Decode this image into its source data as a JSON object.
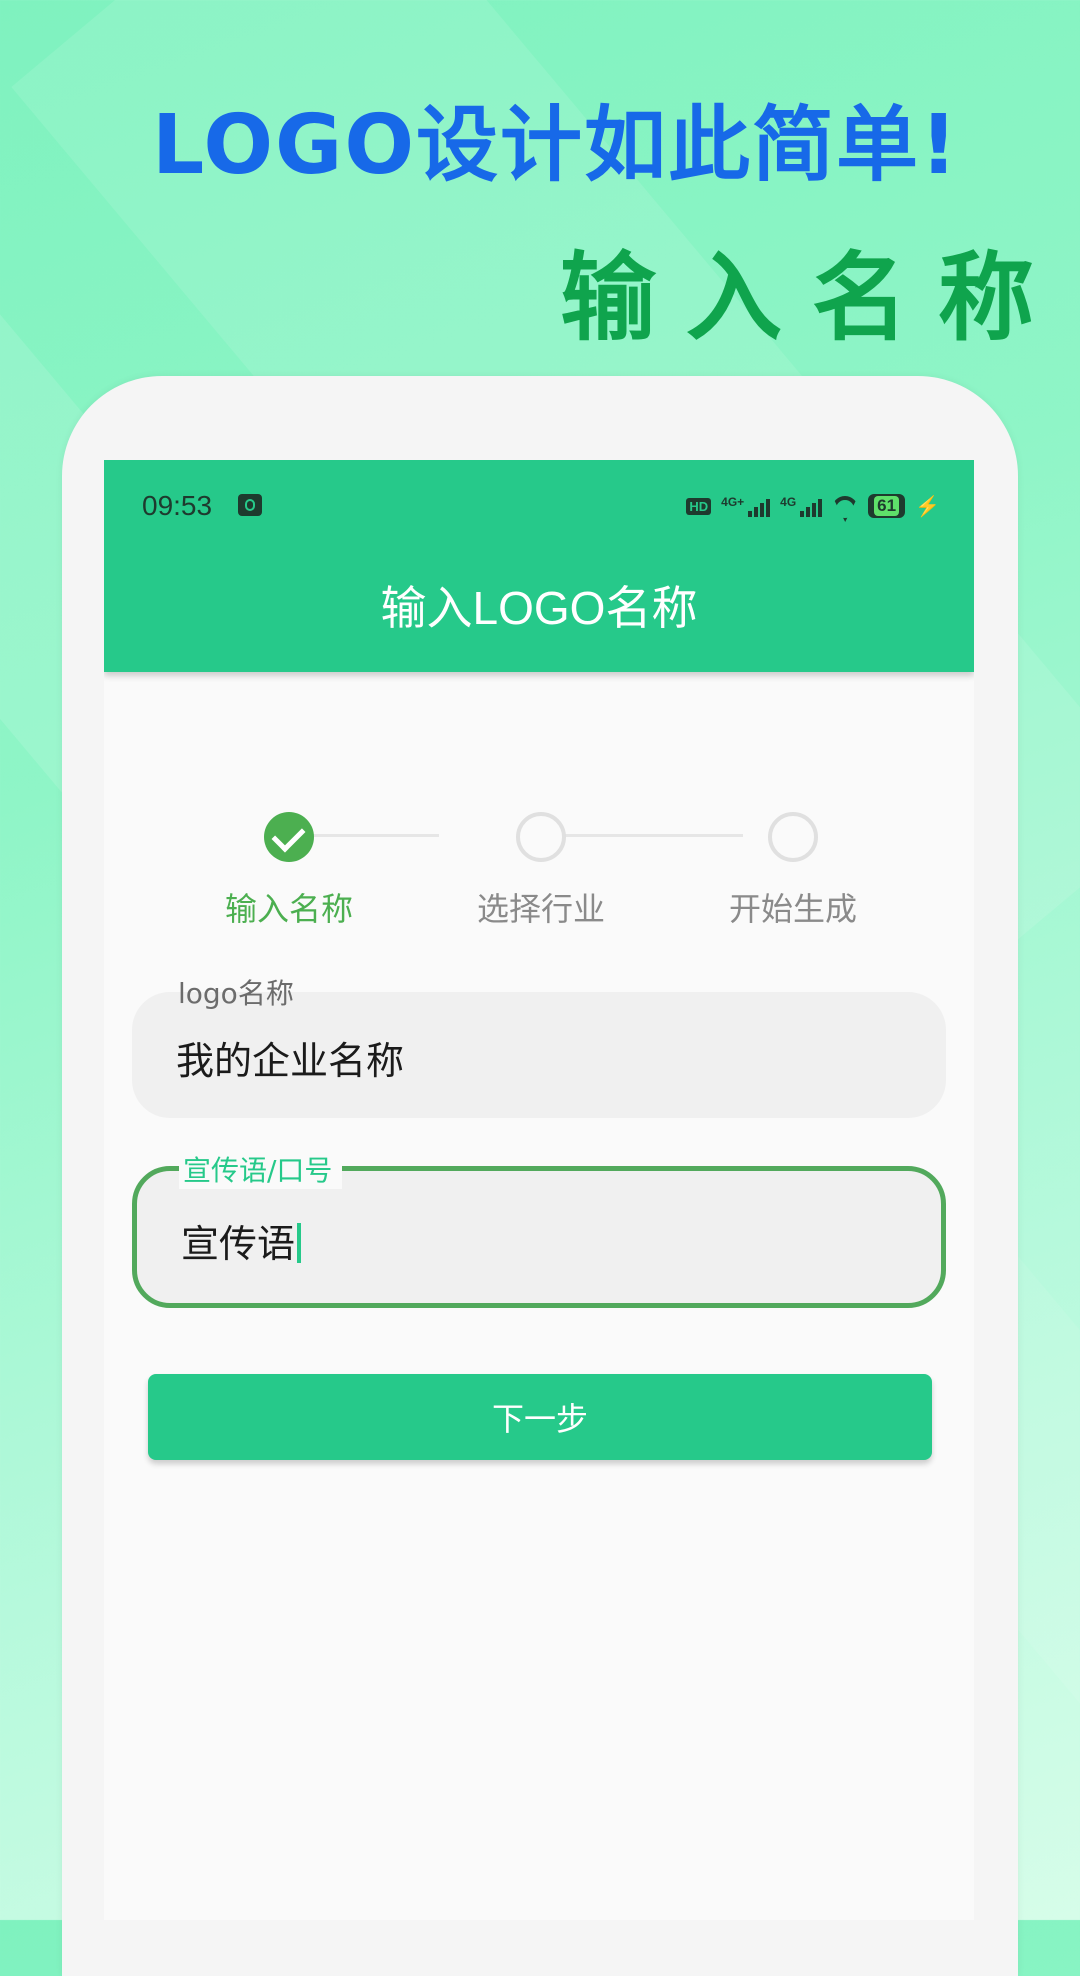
{
  "promo": {
    "title": "LOGO设计如此简单!",
    "subtitle": "输入名称"
  },
  "status_bar": {
    "time": "09:53",
    "hd_label": "HD",
    "network_1": "4G+",
    "network_2": "4G",
    "battery": "61",
    "icons": [
      "app-notification-icon",
      "hd-icon",
      "signal-4g-plus-icon",
      "signal-4g-icon",
      "wifi-icon",
      "battery-icon",
      "charging-icon"
    ]
  },
  "appbar": {
    "title": "输入LOGO名称"
  },
  "stepper": {
    "steps": [
      {
        "label": "输入名称",
        "state": "done"
      },
      {
        "label": "选择行业",
        "state": "todo"
      },
      {
        "label": "开始生成",
        "state": "todo"
      }
    ]
  },
  "form": {
    "logo_name": {
      "label": "logo名称",
      "value": "我的企业名称"
    },
    "slogan": {
      "label": "宣传语/口号",
      "value": "宣传语"
    }
  },
  "actions": {
    "next_label": "下一步"
  },
  "colors": {
    "primary": "#26c98a",
    "step_done": "#4caf50",
    "focus_border": "#52a95c",
    "promo_title": "#1769e8",
    "promo_subtitle": "#0fa44d"
  }
}
